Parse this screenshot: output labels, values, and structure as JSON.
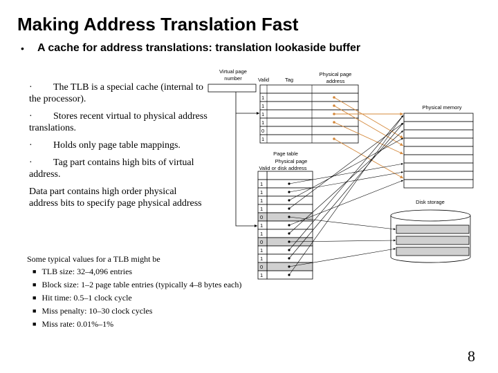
{
  "title": "Making Address Translation Fast",
  "subtitle": "A cache for address translations:  translation lookaside buffer",
  "bullets": [
    "The TLB is a special cache (internal to the processor).",
    "Stores recent virtual to physical address translations.",
    "Holds only page table mappings.",
    "Tag part contains high bits of virtual address."
  ],
  "data_part": "Data part contains high order physical address bits to specify page physical address",
  "typical": {
    "heading": "Some typical values for a TLB might be",
    "items": [
      "TLB size: 32–4,096 entries",
      "Block size: 1–2 page table entries (typically 4–8 bytes each)",
      "Hit time: 0.5–1 clock cycle",
      "Miss penalty: 10–30 clock cycles",
      "Miss rate: 0.01%–1%"
    ]
  },
  "diagram": {
    "vpn_label1": "Virtual page",
    "vpn_label2": "number",
    "valid": "Valid",
    "tag": "Tag",
    "ppa1": "Physical page",
    "ppa2": "address",
    "tlb_valid": [
      "",
      "1",
      "1",
      "1",
      "1",
      "0",
      "1"
    ],
    "phys_mem": "Physical memory",
    "page_table": "Page table",
    "pt_col1": "Physical page",
    "pt_col2": "Valid or disk address",
    "pt_valid": [
      "",
      "1",
      "1",
      "1",
      "1",
      "0",
      "1",
      "1",
      "0",
      "1",
      "1",
      "0",
      "1"
    ],
    "disk": "Disk storage",
    "tlb_arrow_color": "#d4883a"
  },
  "page_number": "8"
}
